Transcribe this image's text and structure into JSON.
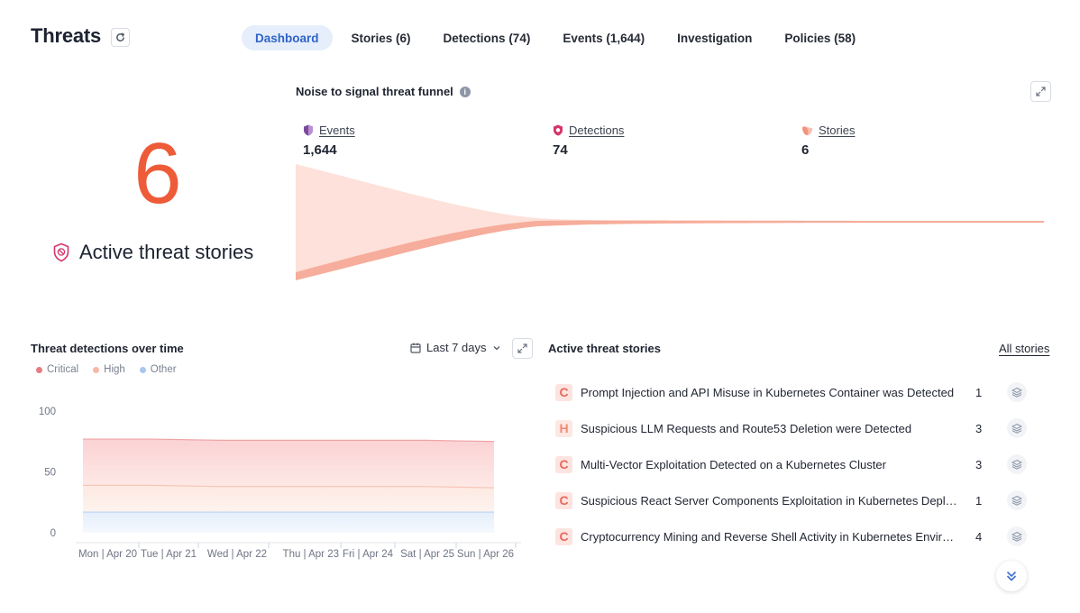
{
  "header": {
    "title": "Threats",
    "tabs": [
      {
        "label": "Dashboard",
        "active": true
      },
      {
        "label": "Stories (6)",
        "active": false
      },
      {
        "label": "Detections (74)",
        "active": false
      },
      {
        "label": "Events (1,644)",
        "active": false
      },
      {
        "label": "Investigation",
        "active": false
      },
      {
        "label": "Policies (58)",
        "active": false
      }
    ]
  },
  "kpi": {
    "value": "6",
    "label": "Active threat stories"
  },
  "funnel": {
    "title": "Noise to signal threat funnel",
    "stages": [
      {
        "label": "Events",
        "value": "1,644",
        "icon": "shield-icon",
        "color": "#7b4a9c"
      },
      {
        "label": "Detections",
        "value": "74",
        "icon": "target-shield-icon",
        "color": "#d6346b"
      },
      {
        "label": "Stories",
        "value": "6",
        "icon": "stories-icon",
        "color": "#f3927d"
      }
    ]
  },
  "detections_chart": {
    "title": "Threat detections over time",
    "range_label": "Last 7 days",
    "legend": [
      {
        "label": "Critical",
        "color": "#e77b82"
      },
      {
        "label": "High",
        "color": "#f6b7a6"
      },
      {
        "label": "Other",
        "color": "#a8c8ee"
      }
    ]
  },
  "chart_data": {
    "type": "area",
    "title": "Threat detections over time",
    "categories": [
      "Mon | Apr 20",
      "Tue | Apr 21",
      "Wed | Apr 22",
      "Thu | Apr 23",
      "Fri | Apr 24",
      "Sat | Apr 25",
      "Sun | Apr 26"
    ],
    "series": [
      {
        "name": "Critical",
        "values": [
          77,
          77,
          76,
          76,
          76,
          76,
          75
        ]
      },
      {
        "name": "High",
        "values": [
          39,
          39,
          38,
          38,
          38,
          38,
          37
        ]
      },
      {
        "name": "Other",
        "values": [
          17,
          17,
          17,
          17,
          17,
          17,
          17
        ]
      }
    ],
    "yticks": [
      "100",
      "50",
      "0"
    ],
    "ylim": [
      0,
      100
    ],
    "grid": false,
    "legend_position": "top-left"
  },
  "stories": {
    "title": "Active threat stories",
    "all_link": "All stories",
    "items": [
      {
        "severity": "C",
        "name": "Prompt Injection and API Misuse in Kubernetes Container was Detected",
        "count": "1"
      },
      {
        "severity": "H",
        "name": "Suspicious LLM Requests and Route53 Deletion were Detected",
        "count": "3"
      },
      {
        "severity": "C",
        "name": "Multi-Vector Exploitation Detected on a Kubernetes Cluster",
        "count": "3"
      },
      {
        "severity": "C",
        "name": "Suspicious React Server Components Exploitation in Kubernetes Deployment",
        "count": "1"
      },
      {
        "severity": "C",
        "name": "Cryptocurrency Mining and Reverse Shell Activity in Kubernetes Environment",
        "count": "4"
      }
    ]
  }
}
